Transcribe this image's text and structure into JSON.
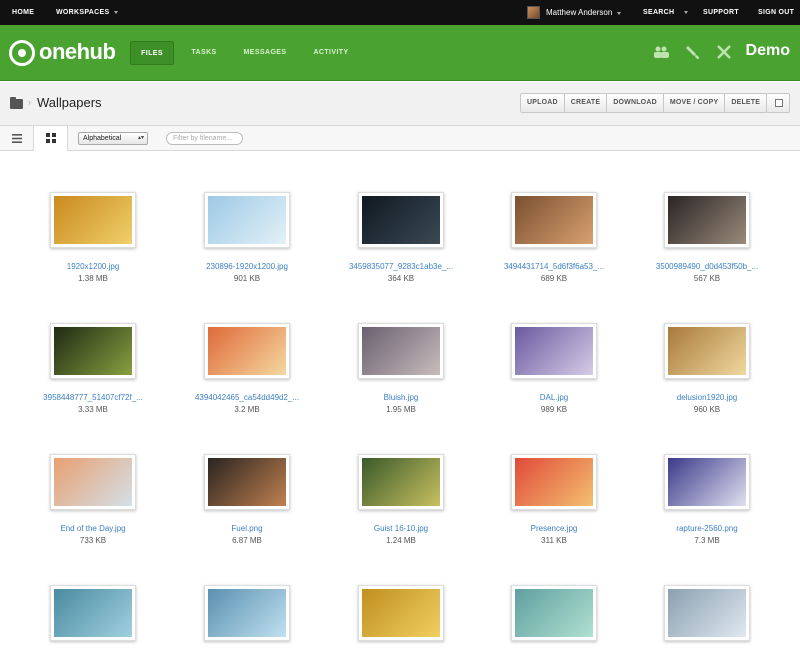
{
  "topbar": {
    "home": "HOME",
    "workspaces": "WORKSPACES",
    "user": "Matthew Anderson",
    "search": "SEARCH",
    "support": "SUPPORT",
    "signout": "SIGN OUT"
  },
  "header": {
    "logo": "onehub",
    "tabs": [
      "FILES",
      "TASKS",
      "MESSAGES",
      "ACTIVITY"
    ],
    "brand": "Demo",
    "icons": [
      "users-icon",
      "brush-icon",
      "tools-icon"
    ]
  },
  "folder": {
    "title": "Wallpapers",
    "actions": [
      "UPLOAD",
      "CREATE",
      "DOWNLOAD",
      "MOVE / COPY",
      "DELETE"
    ]
  },
  "view": {
    "sort": "Alphabetical",
    "filter_placeholder": "Filter by filename..."
  },
  "files": [
    {
      "name": "1920x1200.jpg",
      "size": "1.38 MB",
      "colors": [
        "#c98a1e",
        "#f0cf6a"
      ]
    },
    {
      "name": "230896-1920x1200.jpg",
      "size": "901 KB",
      "colors": [
        "#9ec9e6",
        "#e2f1f7"
      ]
    },
    {
      "name": "3459835077_9283c1ab3e_...",
      "size": "364 KB",
      "colors": [
        "#101820",
        "#3a4a55"
      ]
    },
    {
      "name": "3494431714_5d6f3f6a53_...",
      "size": "689 KB",
      "colors": [
        "#7a5030",
        "#d8a070"
      ]
    },
    {
      "name": "3500989490_d0d453f50b_...",
      "size": "567 KB",
      "colors": [
        "#2a2424",
        "#9a8a7a"
      ]
    },
    {
      "name": "3958448777_51407cf72f_...",
      "size": "3.33 MB",
      "colors": [
        "#1e2a14",
        "#88a040"
      ]
    },
    {
      "name": "4394042465_ca54dd49d2_...",
      "size": "3.2 MB",
      "colors": [
        "#e06a3a",
        "#f4d8a0"
      ]
    },
    {
      "name": "Bluish.jpg",
      "size": "1.95 MB",
      "colors": [
        "#6a6070",
        "#c8bcbc"
      ]
    },
    {
      "name": "DAL.jpg",
      "size": "989 KB",
      "colors": [
        "#6a5aa0",
        "#d6cce6"
      ]
    },
    {
      "name": "delusion1920.jpg",
      "size": "960 KB",
      "colors": [
        "#a87a3a",
        "#f0d8a0"
      ]
    },
    {
      "name": "End of the Day.jpg",
      "size": "733 KB",
      "colors": [
        "#e8a070",
        "#d4e0e8"
      ]
    },
    {
      "name": "Fuel.png",
      "size": "6.87 MB",
      "colors": [
        "#2a2420",
        "#c08050"
      ]
    },
    {
      "name": "Guist 16-10.jpg",
      "size": "1.24 MB",
      "colors": [
        "#3a5a2a",
        "#c8c060"
      ]
    },
    {
      "name": "Presence.jpg",
      "size": "311 KB",
      "colors": [
        "#e04a3a",
        "#f4c070"
      ]
    },
    {
      "name": "rapture-2560.png",
      "size": "7.3 MB",
      "colors": [
        "#3a3a8a",
        "#e0e0f0"
      ]
    },
    {
      "name": "",
      "size": "",
      "colors": [
        "#4a8aa0",
        "#a0d0e0"
      ]
    },
    {
      "name": "",
      "size": "",
      "colors": [
        "#5a90b0",
        "#c0e0f0"
      ]
    },
    {
      "name": "",
      "size": "",
      "colors": [
        "#c09020",
        "#f0d060"
      ]
    },
    {
      "name": "",
      "size": "",
      "colors": [
        "#60a0a0",
        "#b0e0d0"
      ]
    },
    {
      "name": "",
      "size": "",
      "colors": [
        "#8aa0b0",
        "#e0e8f0"
      ]
    }
  ]
}
